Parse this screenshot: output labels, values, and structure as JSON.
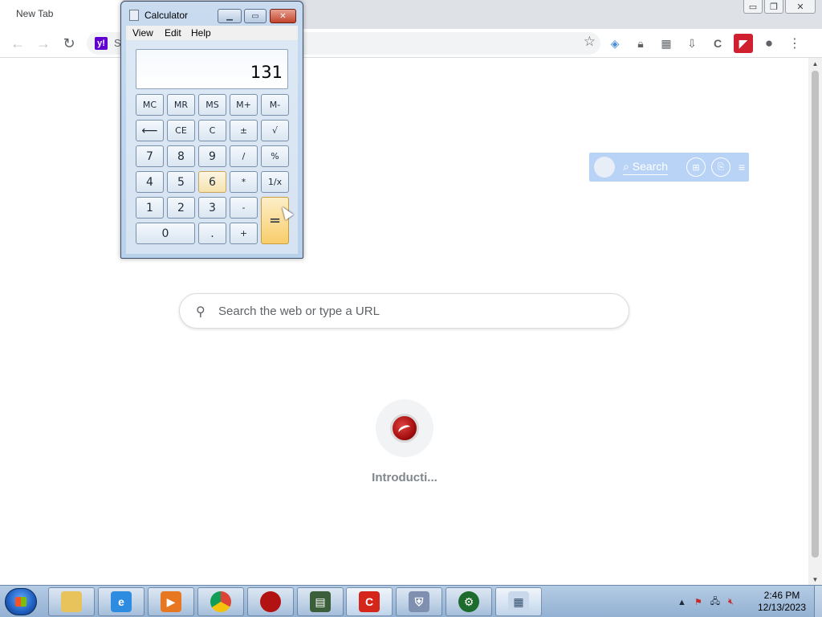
{
  "browser": {
    "tab_title": "New Tab",
    "omnibox_text": "S",
    "search_placeholder": "Search the web or type a URL",
    "search_widget_label": "Search",
    "shortcut_label": "Introducti..."
  },
  "calculator": {
    "title": "Calculator",
    "menu": [
      "View",
      "Edit",
      "Help"
    ],
    "display": "131",
    "buttons": {
      "mc": "MC",
      "mr": "MR",
      "ms": "MS",
      "mplus": "M+",
      "mminus": "M-",
      "back": "⟵",
      "ce": "CE",
      "c": "C",
      "plusminus": "±",
      "sqrt": "√",
      "n7": "7",
      "n8": "8",
      "n9": "9",
      "div": "/",
      "pct": "%",
      "n4": "4",
      "n5": "5",
      "n6": "6",
      "mul": "*",
      "recip": "1/x",
      "n1": "1",
      "n2": "2",
      "n3": "3",
      "minus": "-",
      "eq": "=",
      "n0": "0",
      "dot": ".",
      "plus": "+"
    }
  },
  "taskbar": {
    "time": "2:46 PM",
    "date": "12/13/2023"
  },
  "colors": {
    "yahoo_purple": "#5f01d1",
    "taskbar_blue": "#93b1d3"
  }
}
